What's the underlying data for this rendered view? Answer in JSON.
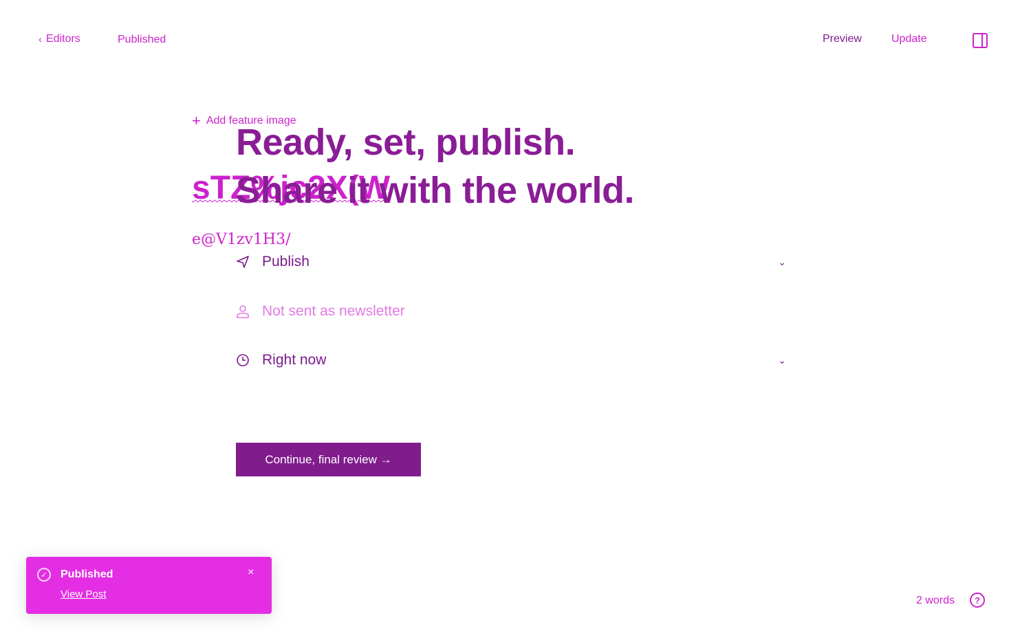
{
  "header": {
    "back_label": "Editors",
    "status": "Published",
    "preview_label": "Preview",
    "update_label": "Update",
    "icons": {
      "back": "chevron-left-icon",
      "sidebar": "sidebar-toggle-icon"
    }
  },
  "editor": {
    "feature_image_label": "Add feature image",
    "title": "sTZ%jc2X(W",
    "body": "e@V1zv1H3/"
  },
  "publish_flow": {
    "headline_line1": "Ready, set, publish.",
    "headline_line2": "Share it with the world.",
    "options": [
      {
        "label": "Publish",
        "icon": "send-icon",
        "has_caret": true
      },
      {
        "label": "Not sent as newsletter",
        "icon": "member-icon",
        "has_caret": false
      },
      {
        "label": "Right now",
        "icon": "clock-icon",
        "has_caret": true
      }
    ],
    "continue_label": "Continue, final review →"
  },
  "toast": {
    "title": "Published",
    "link_label": "View Post",
    "close_icon": "close-icon",
    "status_icon": "check-circle-icon"
  },
  "footer": {
    "word_count": "2 words",
    "help_icon": "question-circle-icon"
  },
  "colors": {
    "accent": "#cc22cc",
    "heading": "#8a1d96",
    "button": "#801c8c",
    "toast": "#e42ee4"
  }
}
